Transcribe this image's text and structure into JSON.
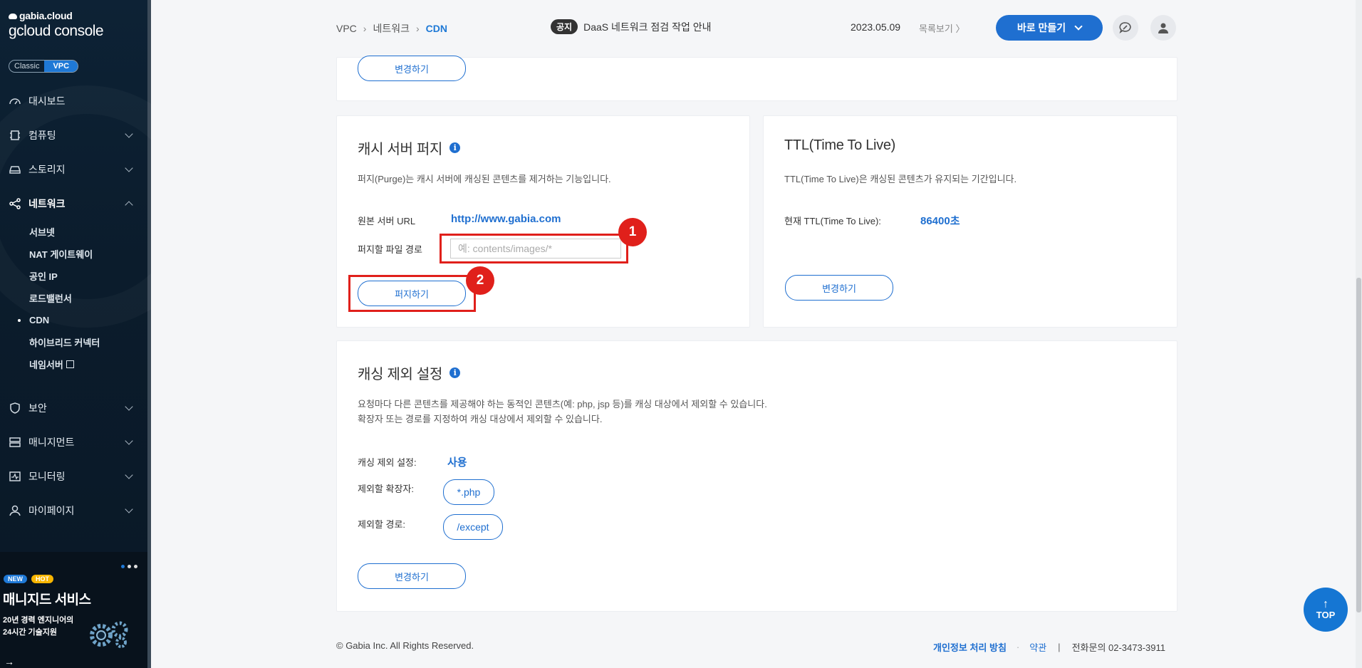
{
  "sidebar": {
    "brand": "gabia.cloud",
    "console": "gcloud console",
    "switch": {
      "classic": "Classic",
      "vpc": "VPC"
    },
    "menu": [
      {
        "label": "대시보드"
      },
      {
        "label": "컴퓨팅"
      },
      {
        "label": "스토리지"
      },
      {
        "label": "네트워크"
      }
    ],
    "network_sub": [
      "서브넷",
      "NAT 게이트웨이",
      "공인 IP",
      "로드밸런서",
      "CDN",
      "하이브리드 커넥터",
      "네임서버"
    ],
    "menu_bottom": [
      {
        "label": "보안"
      },
      {
        "label": "매니지먼트"
      },
      {
        "label": "모니터링"
      },
      {
        "label": "마이페이지"
      }
    ],
    "banner": {
      "badge_new": "NEW",
      "badge_hot": "HOT",
      "title": "매니지드 서비스",
      "desc": "20년 경력 엔지니어의\n24시간 기술지원",
      "arrow": "→"
    }
  },
  "header": {
    "breadcrumb": [
      "VPC",
      "네트워크",
      "CDN"
    ],
    "sep": "›",
    "notice_tag": "공지",
    "notice_text": "DaaS 네트워크 점검 작업 안내",
    "notice_date": "2023.05.09",
    "list_link": "목록보기 〉",
    "create_button": "바로 만들기"
  },
  "top_panel": {
    "change_button": "변경하기"
  },
  "purge": {
    "title": "캐시 서버 퍼지",
    "info_icon": "i",
    "desc": "퍼지(Purge)는 캐시 서버에 캐싱된 콘텐츠를 제거하는 기능입니다.",
    "origin_label": "원본 서버 URL",
    "origin_value": "http://www.gabia.com",
    "path_label": "퍼지할 파일 경로",
    "path_placeholder": "예: contents/images/*",
    "path_value": "",
    "purge_button": "퍼지하기",
    "marker1": "1",
    "marker2": "2"
  },
  "ttl": {
    "title": "TTL(Time To Live)",
    "desc": "TTL(Time To Live)은 캐싱된 콘텐츠가 유지되는 기간입니다.",
    "current_label": "현재 TTL(Time To Live):",
    "current_value": "86400초",
    "change_button": "변경하기"
  },
  "exclude": {
    "title": "캐싱 제외 설정",
    "info_icon": "i",
    "desc1": "요청마다 다른 콘텐츠를 제공해야 하는 동적인 콘텐츠(예: php, jsp 등)를 캐싱 대상에서 제외할 수 있습니다.",
    "desc2": "확장자 또는 경로를 지정하여 캐싱 대상에서 제외할 수 있습니다.",
    "setting_label": "캐싱 제외 설정:",
    "setting_value": "사용",
    "ext_label": "제외할 확장자:",
    "ext_value": "*.php",
    "path_label": "제외할 경로:",
    "path_value": "/except",
    "change_button": "변경하기"
  },
  "footer": {
    "copyright": "© Gabia Inc. All Rights Reserved.",
    "privacy": "개인정보 처리 방침",
    "dot": "·",
    "terms": "약관",
    "bar": "|",
    "tel": "전화문의  02-3473-3911"
  },
  "top_button": {
    "arrow": "↑",
    "label": "TOP"
  },
  "colors": {
    "accent": "#1f6fd0",
    "highlight": "#e0201b",
    "sidebar": "#0d2235"
  }
}
